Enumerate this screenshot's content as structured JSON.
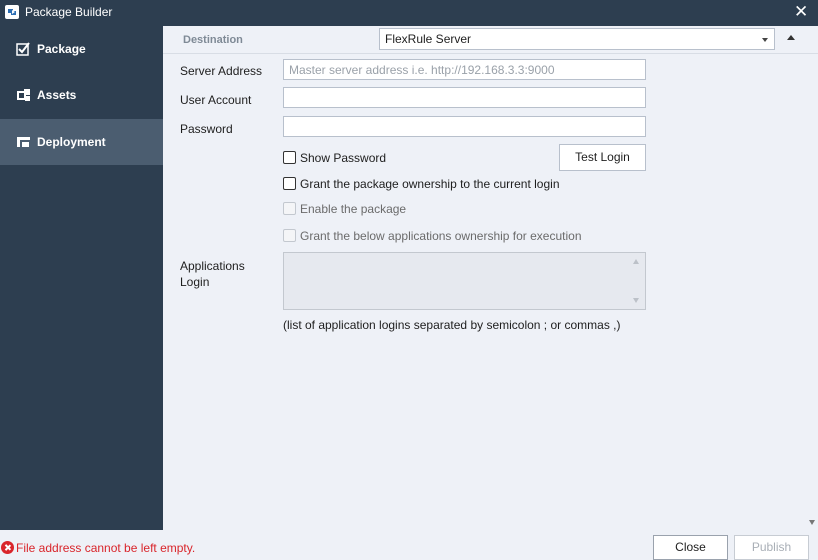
{
  "window": {
    "title": "Package Builder",
    "app_icon": "package-builder-icon",
    "close_icon": "close-icon"
  },
  "sidebar": {
    "items": [
      {
        "label": "Package",
        "icon": "check-icon",
        "active": false
      },
      {
        "label": "Assets",
        "icon": "assets-icon",
        "active": false
      },
      {
        "label": "Deployment",
        "icon": "deployment-icon",
        "active": true
      }
    ]
  },
  "destination": {
    "label": "Destination",
    "selected": "FlexRule Server"
  },
  "form": {
    "server_address": {
      "label": "Server Address",
      "value": "",
      "placeholder": "Master server address i.e. http://192.168.3.3:9000"
    },
    "user_account": {
      "label": "User Account",
      "value": ""
    },
    "password": {
      "label": "Password",
      "value": ""
    },
    "show_password": {
      "label": "Show Password",
      "checked": false
    },
    "test_login_label": "Test Login",
    "grant_ownership": {
      "label": "Grant the package ownership to the current login",
      "checked": false
    },
    "enable_package": {
      "label": "Enable the package",
      "checked": false,
      "disabled": true
    },
    "grant_apps": {
      "label": "Grant the below applications ownership for execution",
      "checked": false,
      "disabled": true
    },
    "applications_login": {
      "label": "Applications Login",
      "value": ""
    },
    "apps_hint": "(list of application logins separated by semicolon ; or commas ,)"
  },
  "status": {
    "error_icon": "error-icon",
    "error_message": "File address cannot be left empty."
  },
  "footer": {
    "close_label": "Close",
    "publish_label": "Publish",
    "publish_enabled": false
  },
  "colors": {
    "sidebar_bg": "#2d3e50",
    "sidebar_active": "#4b5d70",
    "panel_bg": "#eef1f7",
    "error": "#d9252b"
  }
}
